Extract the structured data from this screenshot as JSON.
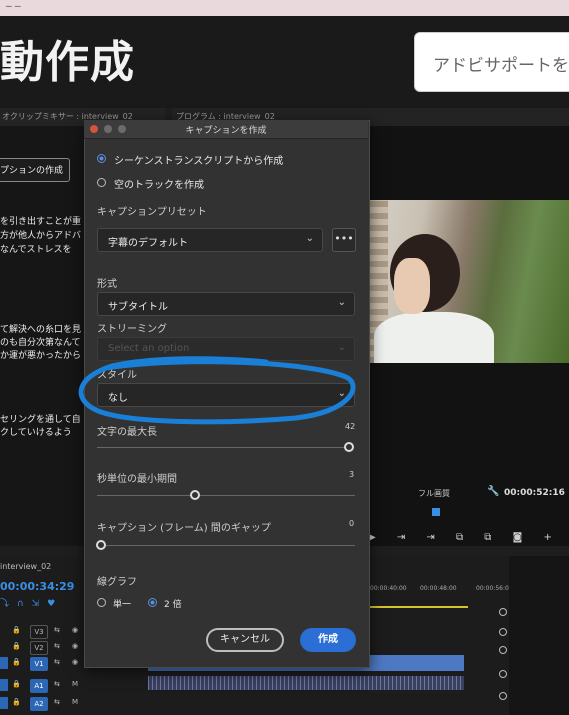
{
  "top_strip": {
    "text": "_ _"
  },
  "page": {
    "title": "動作成",
    "search_placeholder": "アドビサポートを"
  },
  "panels": {
    "source_tab": "オクリップミキサー : interview_02",
    "program_tab": "プログラム : interview_02",
    "caption_button": "プションの作成",
    "transcript_lines": [
      "を引き出すことが重",
      "方が他人からアドバ",
      "なんでストレスを",
      "て解決への糸口を見",
      "のも自分次第なんて",
      "か運が悪かったから",
      "セリングを通して自",
      "クしていけるよう"
    ],
    "quality": "フル画質",
    "timecode": "00:00:52:16"
  },
  "timeline": {
    "tab": "interview_02",
    "timecode": "00:00:34:29",
    "tracks": [
      {
        "name": "V3"
      },
      {
        "name": "V2"
      },
      {
        "name": "V1"
      },
      {
        "name": "A1"
      },
      {
        "name": "A2"
      }
    ],
    "ruler": [
      "00:00:40:00",
      "00:00:48:00",
      "00:00:56:0"
    ]
  },
  "dialog": {
    "title": "キャプションを作成",
    "radio_transcript": "シーケンストランスクリプトから作成",
    "radio_empty": "空のトラックを作成",
    "preset_label": "キャプションプリセット",
    "preset_value": "字幕のデフォルト",
    "more_label": "•••",
    "format_label": "形式",
    "format_value": "サブタイトル",
    "streaming_label": "ストリーミング",
    "streaming_placeholder": "Select an option",
    "style_label": "スタイル",
    "style_value": "なし",
    "max_chars_label": "文字の最大長",
    "max_chars_value": "42",
    "min_duration_label": "秒単位の最小期間",
    "min_duration_value": "3",
    "gap_label": "キャプション (フレーム) 間のギャップ",
    "gap_value": "0",
    "lines_label": "線グラフ",
    "lines_single": "単一",
    "lines_double": "2 倍",
    "cancel": "キャンセル",
    "create": "作成"
  },
  "chart_data": null
}
